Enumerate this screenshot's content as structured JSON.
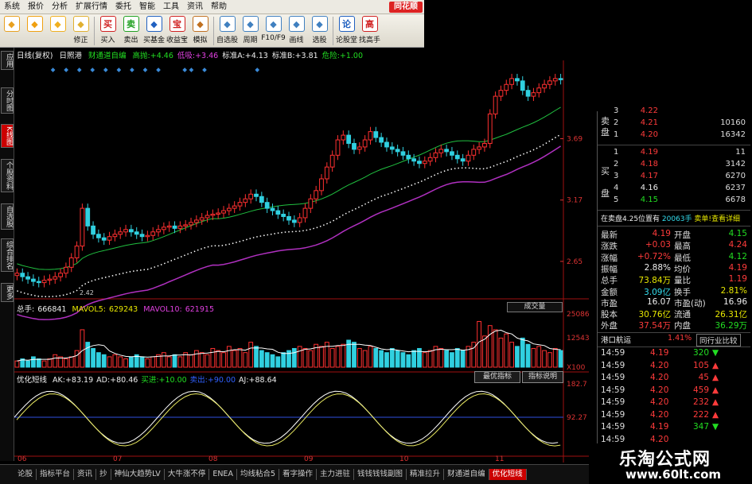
{
  "menu": [
    "系统",
    "报价",
    "分析",
    "扩展行情",
    "委托",
    "智能",
    "工具",
    "资讯",
    "帮助"
  ],
  "brand": "同花顺",
  "toolbar": [
    {
      "label": "",
      "icon": "grid-icon",
      "color": "#e8a020"
    },
    {
      "label": "",
      "icon": "back-arrow-icon",
      "color": "#f0a010"
    },
    {
      "label": "",
      "icon": "up-down-arrows-icon",
      "color": "#f0b020"
    },
    {
      "label": "修正",
      "icon": "refresh-icon",
      "color": "#e0b030"
    },
    {
      "label": "买入",
      "icon": "buy-icon",
      "color": "#d02020",
      "glyph": "买"
    },
    {
      "label": "卖出",
      "icon": "sell-icon",
      "color": "#20a020",
      "glyph": "卖"
    },
    {
      "label": "买基金",
      "icon": "fund-icon",
      "color": "#2060c0"
    },
    {
      "label": "收益宝",
      "icon": "treasure-icon",
      "color": "#d02020",
      "glyph": "宝"
    },
    {
      "label": "模拟",
      "icon": "hammer-icon",
      "color": "#c07020"
    },
    {
      "label": "自选股",
      "icon": "watchlist-icon",
      "color": "#4080c0"
    },
    {
      "label": "周期",
      "icon": "period-icon",
      "color": "#4080c0"
    },
    {
      "label": "F10/F9",
      "icon": "f10-icon",
      "color": "#4080c0"
    },
    {
      "label": "画线",
      "icon": "pencil-icon",
      "color": "#4080c0"
    },
    {
      "label": "选股",
      "icon": "stock-pick-icon",
      "color": "#4080c0"
    },
    {
      "label": "论股堂",
      "icon": "discuss-icon",
      "color": "#2060c0",
      "glyph": "论"
    },
    {
      "label": "找高手",
      "icon": "expert-icon",
      "color": "#d02020",
      "glyph": "高"
    }
  ],
  "left_tabs": [
    {
      "label": "应用",
      "active": false
    },
    {
      "label": "分时图",
      "active": false
    },
    {
      "label": "K线图",
      "active": true
    },
    {
      "label": "个股资料",
      "active": false
    },
    {
      "label": "自选股",
      "active": false
    },
    {
      "label": "综合排名",
      "active": false
    },
    {
      "label": "更多",
      "active": false
    }
  ],
  "main_header": {
    "period": "日线(复权)",
    "name": "日照港",
    "indicator": "财通道自编",
    "items": [
      {
        "label": "高抛:",
        "value": "+4.46",
        "color": "#22dd22"
      },
      {
        "label": "低吸:",
        "value": "+3.46",
        "color": "#e040e0"
      },
      {
        "label": "标准A:",
        "value": "+4.13",
        "color": "#eeeeee"
      },
      {
        "label": "标准B:",
        "value": "+3.81",
        "color": "#eeeeee"
      },
      {
        "label": "危险:",
        "value": "+1.00",
        "color": "#22dd22"
      }
    ]
  },
  "price_axis": [
    "3.69",
    "3.17",
    "2.65"
  ],
  "price_annotations": [
    "2.42"
  ],
  "vol_header": {
    "label": "总手:",
    "value": "666841",
    "ma5_label": "MAVOL5:",
    "ma5": "629243",
    "ma10_label": "MAVOL10:",
    "ma10": "621915",
    "selector": "成交量"
  },
  "vol_axis": [
    "25086",
    "12543",
    "X100"
  ],
  "ind_header": {
    "name": "优化短线",
    "items": [
      {
        "label": "AK:",
        "value": "+83.19",
        "color": "#eeeeee"
      },
      {
        "label": "AD:",
        "value": "+80.46",
        "color": "#eeeeee"
      },
      {
        "label": "买进:",
        "value": "+10.00",
        "color": "#22dd22"
      },
      {
        "label": "卖出:",
        "value": "+90.00",
        "color": "#3060ff"
      },
      {
        "label": "AJ:",
        "value": "+88.64",
        "color": "#eeeeee"
      }
    ],
    "btn1": "最优指标",
    "btn2": "指标说明"
  },
  "ind_axis": [
    "182.7",
    "92.27"
  ],
  "date_axis": [
    "06",
    "07",
    "08",
    "09",
    "10",
    "11"
  ],
  "bottom_tabs": [
    {
      "label": "论股",
      "active": false
    },
    {
      "label": "指标平台",
      "active": false
    },
    {
      "label": "资讯",
      "active": false
    },
    {
      "label": "抄",
      "active": false
    },
    {
      "label": "神仙大趋势LV",
      "active": false
    },
    {
      "label": "大牛涨不停",
      "active": false
    },
    {
      "label": "ENEA",
      "active": false
    },
    {
      "label": "均线粘合5",
      "active": false
    },
    {
      "label": "看字操作",
      "active": false
    },
    {
      "label": "主力进驻",
      "active": false
    },
    {
      "label": "钱钱钱钱副图",
      "active": false
    },
    {
      "label": "精准拉升",
      "active": false
    },
    {
      "label": "财通道自编",
      "active": false
    },
    {
      "label": "优化短线",
      "active": true
    }
  ],
  "orderbook": {
    "sell_label": "卖\n盘",
    "buy_label": "买\n盘",
    "sells": [
      {
        "n": "3",
        "price": "4.22",
        "vol": "",
        "color": "#ff3b3b"
      },
      {
        "n": "2",
        "price": "4.21",
        "vol": "10160",
        "color": "#ff3b3b"
      },
      {
        "n": "1",
        "price": "4.20",
        "vol": "16342",
        "color": "#ff3b3b"
      }
    ],
    "buys": [
      {
        "n": "1",
        "price": "4.19",
        "vol": "11",
        "color": "#ff3b3b"
      },
      {
        "n": "2",
        "price": "4.18",
        "vol": "3142",
        "color": "#ff3b3b"
      },
      {
        "n": "3",
        "price": "4.17",
        "vol": "6270",
        "color": "#ff3b3b"
      },
      {
        "n": "4",
        "price": "4.16",
        "vol": "6237",
        "color": "#eeeeee"
      },
      {
        "n": "5",
        "price": "4.15",
        "vol": "6678",
        "color": "#22dd22"
      }
    ]
  },
  "status_line": {
    "left": "在卖盘4.25位置有",
    "mid": "20063手",
    "right": "卖单!查看详细"
  },
  "quote": [
    {
      "l1": "最新",
      "v1": "4.19",
      "c1": "#ff3b3b",
      "l2": "开盘",
      "v2": "4.15",
      "c2": "#22dd22"
    },
    {
      "l1": "涨跌",
      "v1": "+0.03",
      "c1": "#ff3b3b",
      "l2": "最高",
      "v2": "4.24",
      "c2": "#ff3b3b"
    },
    {
      "l1": "涨幅",
      "v1": "+0.72%",
      "c1": "#ff3b3b",
      "l2": "最低",
      "v2": "4.12",
      "c2": "#22dd22"
    },
    {
      "l1": "振幅",
      "v1": "2.88%",
      "c1": "#eeeeee",
      "l2": "均价",
      "v2": "4.19",
      "c2": "#ff3b3b"
    },
    {
      "l1": "总手",
      "v1": "73.84万",
      "c1": "#e8e800",
      "l2": "量比",
      "v2": "1.19",
      "c2": "#ff3b3b"
    },
    {
      "l1": "金额",
      "v1": "3.09亿",
      "c1": "#33ddee",
      "l2": "换手",
      "v2": "2.81%",
      "c2": "#e8e800"
    },
    {
      "l1": "市盈",
      "v1": "16.07",
      "c1": "#eeeeee",
      "l2": "市盈(动)",
      "v2": "16.96",
      "c2": "#eeeeee"
    },
    {
      "l1": "股本",
      "v1": "30.76亿",
      "c1": "#e8e800",
      "l2": "流通",
      "v2": "26.31亿",
      "c2": "#e8e800"
    },
    {
      "l1": "外盘",
      "v1": "37.54万",
      "c1": "#ff3b3b",
      "l2": "内盘",
      "v2": "36.29万",
      "c2": "#22dd22"
    }
  ],
  "sector": {
    "name": "港口航运",
    "change": "1.41%",
    "compare": "同行业比较"
  },
  "ticks": [
    {
      "time": "14:59",
      "price": "4.19",
      "pc": "#ff3b3b",
      "vol": "320",
      "vc": "#22dd22",
      "dir": "down"
    },
    {
      "time": "14:59",
      "price": "4.20",
      "pc": "#ff3b3b",
      "vol": "105",
      "vc": "#ff3b3b",
      "dir": "up"
    },
    {
      "time": "14:59",
      "price": "4.20",
      "pc": "#ff3b3b",
      "vol": "45",
      "vc": "#ff3b3b",
      "dir": "up"
    },
    {
      "time": "14:59",
      "price": "4.20",
      "pc": "#ff3b3b",
      "vol": "459",
      "vc": "#ff3b3b",
      "dir": "up"
    },
    {
      "time": "14:59",
      "price": "4.20",
      "pc": "#ff3b3b",
      "vol": "232",
      "vc": "#ff3b3b",
      "dir": "up"
    },
    {
      "time": "14:59",
      "price": "4.20",
      "pc": "#ff3b3b",
      "vol": "222",
      "vc": "#ff3b3b",
      "dir": "up"
    },
    {
      "time": "14:59",
      "price": "4.19",
      "pc": "#ff3b3b",
      "vol": "347",
      "vc": "#22dd22",
      "dir": "down"
    },
    {
      "time": "14:59",
      "price": "4.20",
      "pc": "#ff3b3b",
      "vol": "",
      "vc": "#ff3b3b",
      "dir": ""
    }
  ],
  "watermark": {
    "line1": "乐淘公式网",
    "line2": "www.60lt.com"
  },
  "chart_data": {
    "type": "candlestick",
    "price_range": [
      2.4,
      4.3
    ],
    "price_ticks": [
      2.65,
      3.17,
      3.69
    ],
    "closes": [
      2.55,
      2.52,
      2.5,
      2.48,
      2.47,
      2.49,
      2.5,
      2.52,
      2.55,
      2.6,
      2.68,
      2.78,
      3.1,
      2.95,
      2.88,
      2.85,
      2.83,
      2.86,
      2.88,
      2.9,
      2.92,
      2.9,
      2.88,
      2.86,
      2.87,
      2.9,
      2.92,
      2.94,
      2.95,
      2.93,
      2.95,
      2.96,
      2.98,
      3.0,
      3.02,
      3.04,
      3.05,
      3.06,
      3.08,
      3.1,
      3.12,
      3.15,
      3.18,
      3.22,
      3.2,
      3.15,
      3.1,
      3.08,
      3.05,
      3.03,
      3.0,
      2.98,
      3.02,
      3.1,
      3.18,
      3.25,
      3.35,
      3.45,
      3.55,
      3.68,
      3.72,
      3.65,
      3.6,
      3.62,
      3.68,
      3.75,
      3.7,
      3.66,
      3.62,
      3.6,
      3.58,
      3.55,
      3.52,
      3.5,
      3.48,
      3.5,
      3.53,
      3.57,
      3.6,
      3.58,
      3.55,
      3.52,
      3.5,
      3.55,
      3.6,
      3.62,
      3.65,
      3.9,
      4.05,
      4.1,
      4.15,
      4.2,
      4.18,
      4.1,
      4.05,
      4.08,
      4.12,
      4.15,
      4.18,
      4.2,
      4.19
    ],
    "volumes": [
      3,
      4,
      3,
      5,
      4,
      3,
      4,
      6,
      5,
      4,
      5,
      8,
      18,
      12,
      9,
      7,
      6,
      5,
      6,
      5,
      4,
      5,
      6,
      5,
      4,
      5,
      6,
      7,
      5,
      6,
      5,
      7,
      6,
      8,
      7,
      6,
      9,
      8,
      7,
      10,
      8,
      9,
      7,
      12,
      10,
      8,
      7,
      6,
      5,
      7,
      8,
      9,
      10,
      9,
      8,
      11,
      10,
      12,
      9,
      10,
      11,
      13,
      12,
      9,
      8,
      10,
      9,
      8,
      7,
      9,
      8,
      7,
      6,
      8,
      9,
      7,
      8,
      10,
      9,
      8,
      7,
      9,
      8,
      10,
      12,
      22,
      15,
      20,
      18,
      14,
      16,
      12,
      10,
      14,
      11,
      9,
      10,
      8,
      7,
      9,
      8
    ],
    "volume_ticks": [
      12543,
      25086
    ],
    "indicator_ticks": [
      92.27,
      182.7
    ]
  }
}
